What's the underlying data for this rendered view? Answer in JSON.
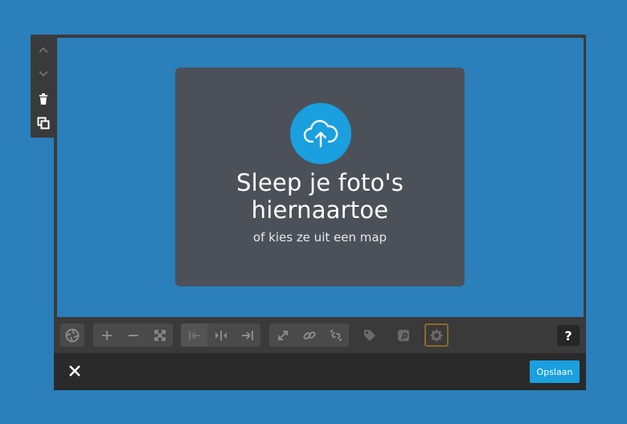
{
  "side_toolbar": {
    "items": [
      {
        "icon": "chevron-up-icon"
      },
      {
        "icon": "chevron-down-icon"
      },
      {
        "icon": "trash-icon"
      },
      {
        "icon": "duplicate-icon"
      }
    ]
  },
  "dropzone": {
    "title_line1": "Sleep je foto's",
    "title_line2": "hiernaartoe",
    "subtitle": "of kies ze uit een map",
    "icon": "cloud-upload-icon"
  },
  "toolbar": {
    "groups": [
      [
        "shutter-icon"
      ],
      [
        "zoom-in-icon",
        "zoom-out-icon",
        "fit-icon"
      ],
      [
        "align-left-icon",
        "align-center-icon",
        "align-right-icon"
      ],
      [
        "resize-icon",
        "link-icon",
        "unlink-icon"
      ],
      [
        "tag-icon"
      ],
      [
        "pinterest-icon"
      ],
      [
        "settings-icon"
      ]
    ],
    "help_label": "?"
  },
  "footer": {
    "close_icon": "close-icon",
    "save_label": "Opslaan"
  },
  "colors": {
    "background": "#2b7fba",
    "editor": "#3a3a3a",
    "dropzone": "#4c5159",
    "accent": "#1a9fdf",
    "footer": "#2a2a2a"
  }
}
